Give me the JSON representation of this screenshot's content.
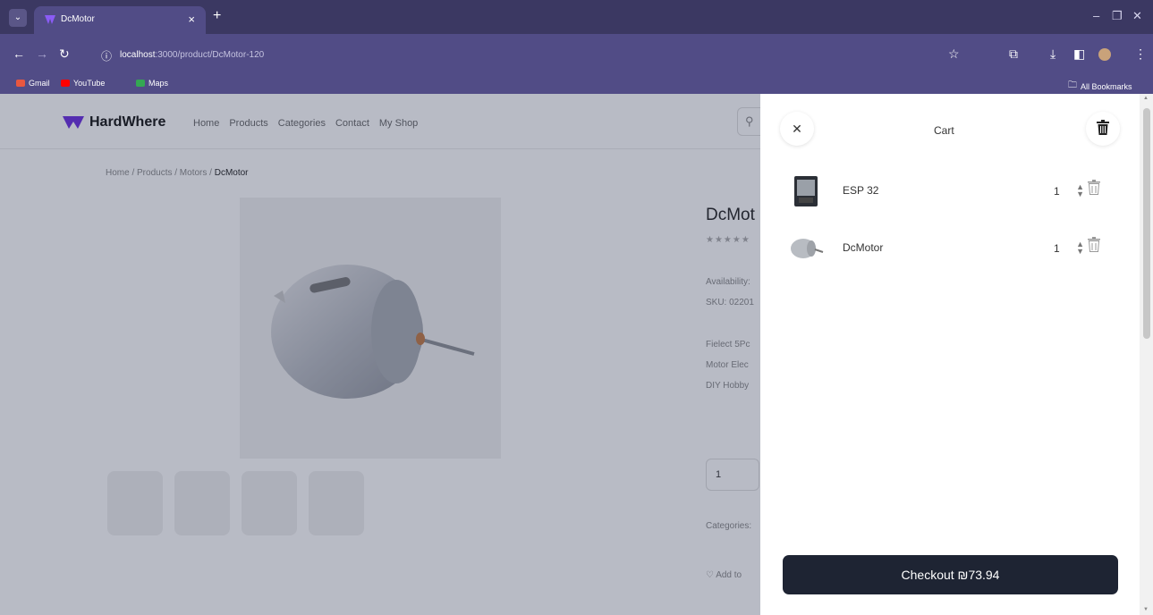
{
  "browser": {
    "tab_title": "DcMotor",
    "url_host": "localhost",
    "url_path": ":3000/product/DcMotor-120",
    "bookmarks": [
      "Gmail",
      "YouTube",
      "Maps"
    ],
    "all_bookmarks": "All Bookmarks"
  },
  "site": {
    "brand": "HardWhere",
    "nav": [
      "Home",
      "Products",
      "Categories",
      "Contact",
      "My Shop"
    ]
  },
  "breadcrumb": {
    "path": "Home / Products / Motors / ",
    "current": "DcMotor"
  },
  "product": {
    "title": "DcMot",
    "availability": "Availability:",
    "sku": "SKU: 02201",
    "desc_lines": [
      "Fielect 5Pc",
      "Motor Elec",
      "DIY Hobby"
    ],
    "qty": "1",
    "categories": "Categories:",
    "add_to": "Add to"
  },
  "cart": {
    "title": "Cart",
    "items": [
      {
        "name": "ESP 32",
        "qty": "1"
      },
      {
        "name": "DcMotor",
        "qty": "1"
      }
    ],
    "checkout_label": "Checkout ₪73.94"
  },
  "colors": {
    "chrome_dark": "#3b3862",
    "chrome": "#514c86",
    "checkout_bg": "#1e2433",
    "brand_purple": "#6a2ce0"
  }
}
